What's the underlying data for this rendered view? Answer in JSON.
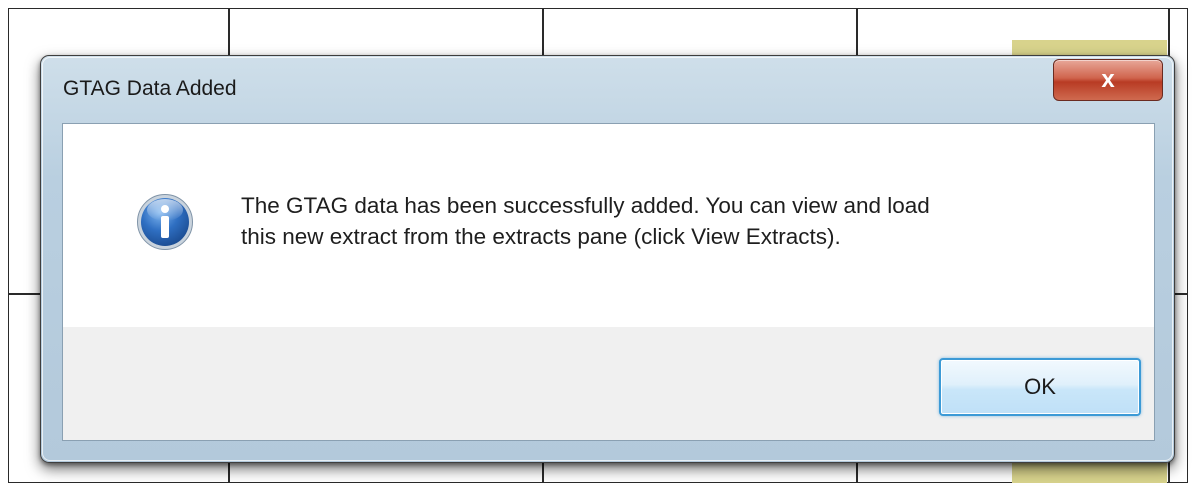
{
  "dialog": {
    "title": "GTAG Data Added",
    "close_label": "x",
    "icon": "info-icon",
    "message_line1": "The GTAG data has been successfully added. You can view and load",
    "message_line2": "this new extract from the extracts pane (click View Extracts).",
    "ok_label": "OK"
  },
  "colors": {
    "dialog_frame": "#b9cfe0",
    "close_button": "#c8503a",
    "ok_border": "#3c9ad6",
    "info_icon": "#2f6fc2",
    "highlight_cell": "#d8d38c"
  }
}
